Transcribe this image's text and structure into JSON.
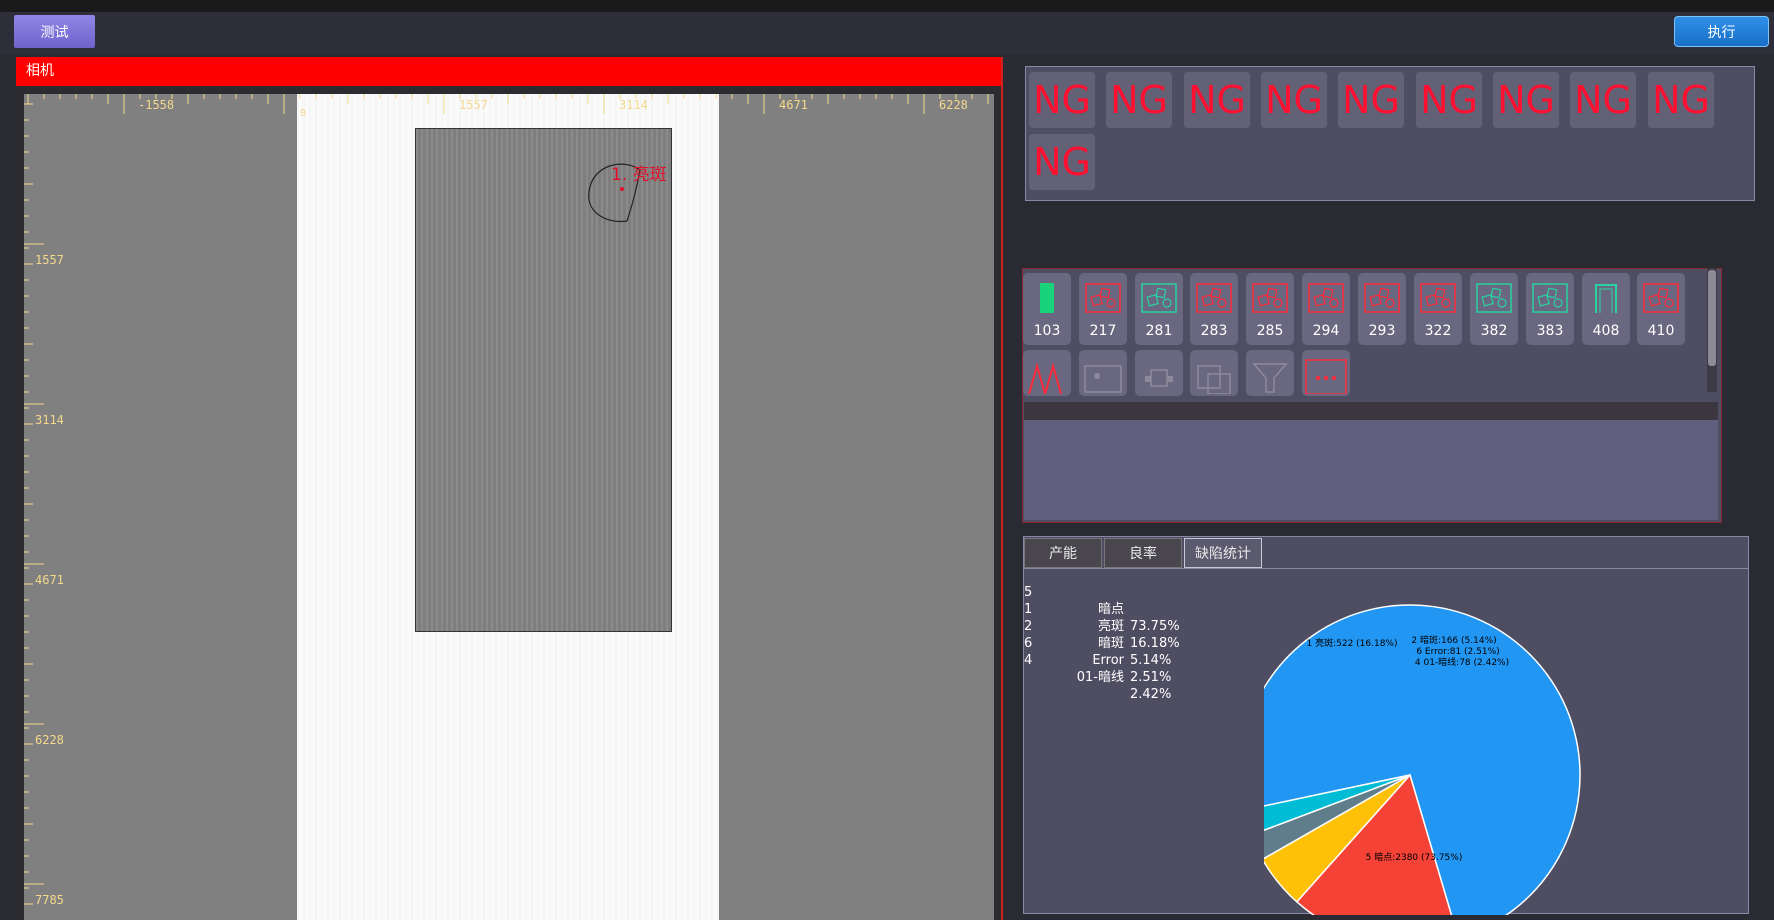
{
  "toolbar": {
    "test_label": "测试",
    "exec_label": "执行"
  },
  "camera": {
    "title": "相机",
    "ruler_top": [
      "-1558",
      "0",
      "1557",
      "3114",
      "4671",
      "6228"
    ],
    "ruler_left": [
      "1557",
      "3114",
      "4671",
      "6228",
      "7785"
    ],
    "defect_label": "1. 亮斑"
  },
  "ng_results": [
    "NG",
    "NG",
    "NG",
    "NG",
    "NG",
    "NG",
    "NG",
    "NG",
    "NG",
    "NG"
  ],
  "tools": {
    "row1": [
      {
        "id": "103",
        "icon": "green-bar-icon"
      },
      {
        "id": "217",
        "icon": "defect-red-icon"
      },
      {
        "id": "281",
        "icon": "defect-green-icon"
      },
      {
        "id": "283",
        "icon": "defect-red-icon"
      },
      {
        "id": "285",
        "icon": "defect-red-icon"
      },
      {
        "id": "294",
        "icon": "defect-red-icon"
      },
      {
        "id": "293",
        "icon": "defect-red-icon"
      },
      {
        "id": "322",
        "icon": "defect-red-icon"
      },
      {
        "id": "382",
        "icon": "defect-green-icon"
      },
      {
        "id": "383",
        "icon": "defect-green-icon"
      },
      {
        "id": "408",
        "icon": "frame-green-icon"
      },
      {
        "id": "410",
        "icon": "defect-red-icon"
      }
    ],
    "row2_icons": [
      "wave-icon",
      "image-icon",
      "camera-mount-icon",
      "region-icon",
      "filter-icon",
      "more-icon"
    ]
  },
  "stats": {
    "tabs": [
      "产能",
      "良率",
      "缺陷统计"
    ],
    "active_tab": 2,
    "legend": [
      {
        "id": "5",
        "name": "暗点",
        "pct": "73.75%"
      },
      {
        "id": "1",
        "name": "亮斑",
        "pct": "16.18%"
      },
      {
        "id": "2",
        "name": "暗斑",
        "pct": "5.14%"
      },
      {
        "id": "6",
        "name": "Error",
        "pct": "2.51%"
      },
      {
        "id": "4",
        "name": "01-暗线",
        "pct": "2.42%"
      }
    ]
  },
  "chart_data": {
    "type": "pie",
    "slices": [
      {
        "label": "5 暗点:2380 (73.75%)",
        "value": 2380,
        "pct": 73.75,
        "color": "#2196f3"
      },
      {
        "label": "1 亮斑:522 (16.18%)",
        "value": 522,
        "pct": 16.18,
        "color": "#f44336"
      },
      {
        "label": "2 暗斑:166 (5.14%)",
        "value": 166,
        "pct": 5.14,
        "color": "#ffc107"
      },
      {
        "label": "6 Error:81 (2.51%)",
        "value": 81,
        "pct": 2.51,
        "color": "#607d8b"
      },
      {
        "label": "4 01-暗线:78 (2.42%)",
        "value": 78,
        "pct": 2.42,
        "color": "#00bcd4"
      }
    ]
  }
}
